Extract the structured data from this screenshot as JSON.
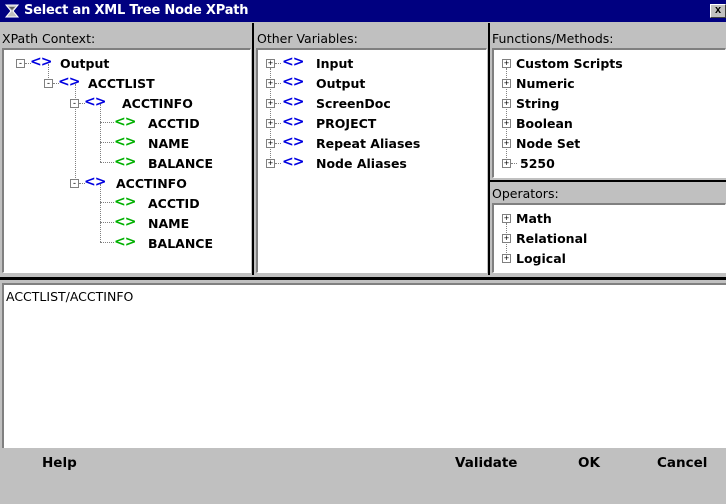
{
  "window": {
    "title": "Select an XML Tree Node XPath",
    "close_label": "x"
  },
  "xpath_context": {
    "label": "XPath Context:",
    "tree": {
      "root": "Output",
      "acctlist": "ACCTLIST",
      "acctinfo_1": "ACCTINFO",
      "acctid_1": "ACCTID",
      "name_1": "NAME",
      "balance_1": "BALANCE",
      "acctinfo_2": "ACCTINFO",
      "acctid_2": "ACCTID",
      "name_2": "NAME",
      "balance_2": "BALANCE"
    }
  },
  "other_variables": {
    "label": "Other Variables:",
    "items": [
      "Input",
      "Output",
      "ScreenDoc",
      "PROJECT",
      "Repeat Aliases",
      "Node Aliases"
    ]
  },
  "functions": {
    "label": "Functions/Methods:",
    "items": [
      "Custom Scripts",
      "Numeric",
      "String",
      "Boolean",
      "Node Set",
      "5250"
    ]
  },
  "operators": {
    "label": "Operators:",
    "items": [
      "Math",
      "Relational",
      "Logical"
    ]
  },
  "xpath_text": "ACCTLIST/ACCTINFO",
  "icons": {
    "element_icon": "<>",
    "expand_icon": "+",
    "collapse_icon": "-"
  },
  "colors": {
    "title_bg": "#000080",
    "element_icon_blue": "#0000e0",
    "element_icon_green": "#00b000"
  },
  "buttons": {
    "help": "Help",
    "validate": "Validate",
    "ok": "OK",
    "cancel": "Cancel"
  }
}
